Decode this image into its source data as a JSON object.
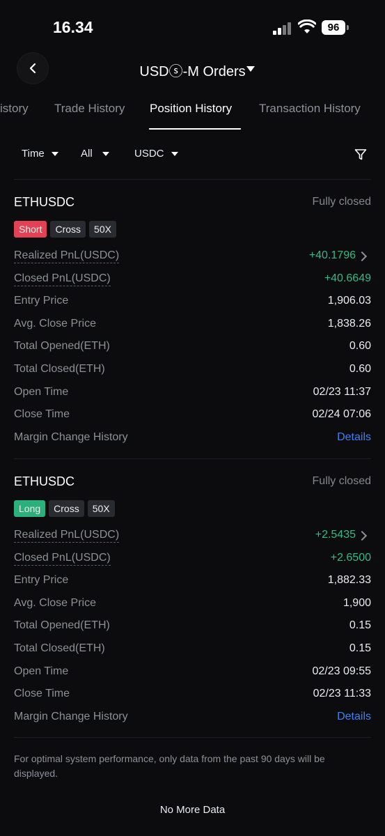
{
  "status_bar": {
    "time": "16.34",
    "battery": "96"
  },
  "header": {
    "title": "USDⓢ-M Orders"
  },
  "tabs": [
    {
      "label": "istory"
    },
    {
      "label": "Trade History"
    },
    {
      "label": "Position History"
    },
    {
      "label": "Transaction History"
    }
  ],
  "filters": {
    "time": "Time",
    "side": "All",
    "asset": "USDC"
  },
  "positions": [
    {
      "symbol": "ETHUSDC",
      "state": "Fully closed",
      "side": "Short",
      "margin_mode": "Cross",
      "leverage": "50X",
      "rows": {
        "realized_pnl": {
          "label": "Realized PnL(USDC)",
          "value": "+40.1796"
        },
        "closed_pnl": {
          "label": "Closed PnL(USDC)",
          "value": "+40.6649"
        },
        "entry_price": {
          "label": "Entry Price",
          "value": "1,906.03"
        },
        "avg_close_price": {
          "label": "Avg. Close Price",
          "value": "1,838.26"
        },
        "total_opened": {
          "label": "Total Opened(ETH)",
          "value": "0.60"
        },
        "total_closed": {
          "label": "Total Closed(ETH)",
          "value": "0.60"
        },
        "open_time": {
          "label": "Open Time",
          "value": "02/23 11:37"
        },
        "close_time": {
          "label": "Close Time",
          "value": "02/24 07:06"
        },
        "margin_change": {
          "label": "Margin Change History",
          "value": "Details"
        }
      }
    },
    {
      "symbol": "ETHUSDC",
      "state": "Fully closed",
      "side": "Long",
      "margin_mode": "Cross",
      "leverage": "50X",
      "rows": {
        "realized_pnl": {
          "label": "Realized PnL(USDC)",
          "value": "+2.5435"
        },
        "closed_pnl": {
          "label": "Closed PnL(USDC)",
          "value": "+2.6500"
        },
        "entry_price": {
          "label": "Entry Price",
          "value": "1,882.33"
        },
        "avg_close_price": {
          "label": "Avg. Close Price",
          "value": "1,900"
        },
        "total_opened": {
          "label": "Total Opened(ETH)",
          "value": "0.15"
        },
        "total_closed": {
          "label": "Total Closed(ETH)",
          "value": "0.15"
        },
        "open_time": {
          "label": "Open Time",
          "value": "02/23 09:55"
        },
        "close_time": {
          "label": "Close Time",
          "value": "02/23 11:33"
        },
        "margin_change": {
          "label": "Margin Change History",
          "value": "Details"
        }
      }
    }
  ],
  "footer": {
    "note": "For optimal system performance, only data from the past 90 days will be displayed.",
    "no_more": "No More Data"
  },
  "colors": {
    "profit": "#2ebd85",
    "short": "#f6465d",
    "long": "#2ebd85",
    "link": "#3b82f6"
  }
}
